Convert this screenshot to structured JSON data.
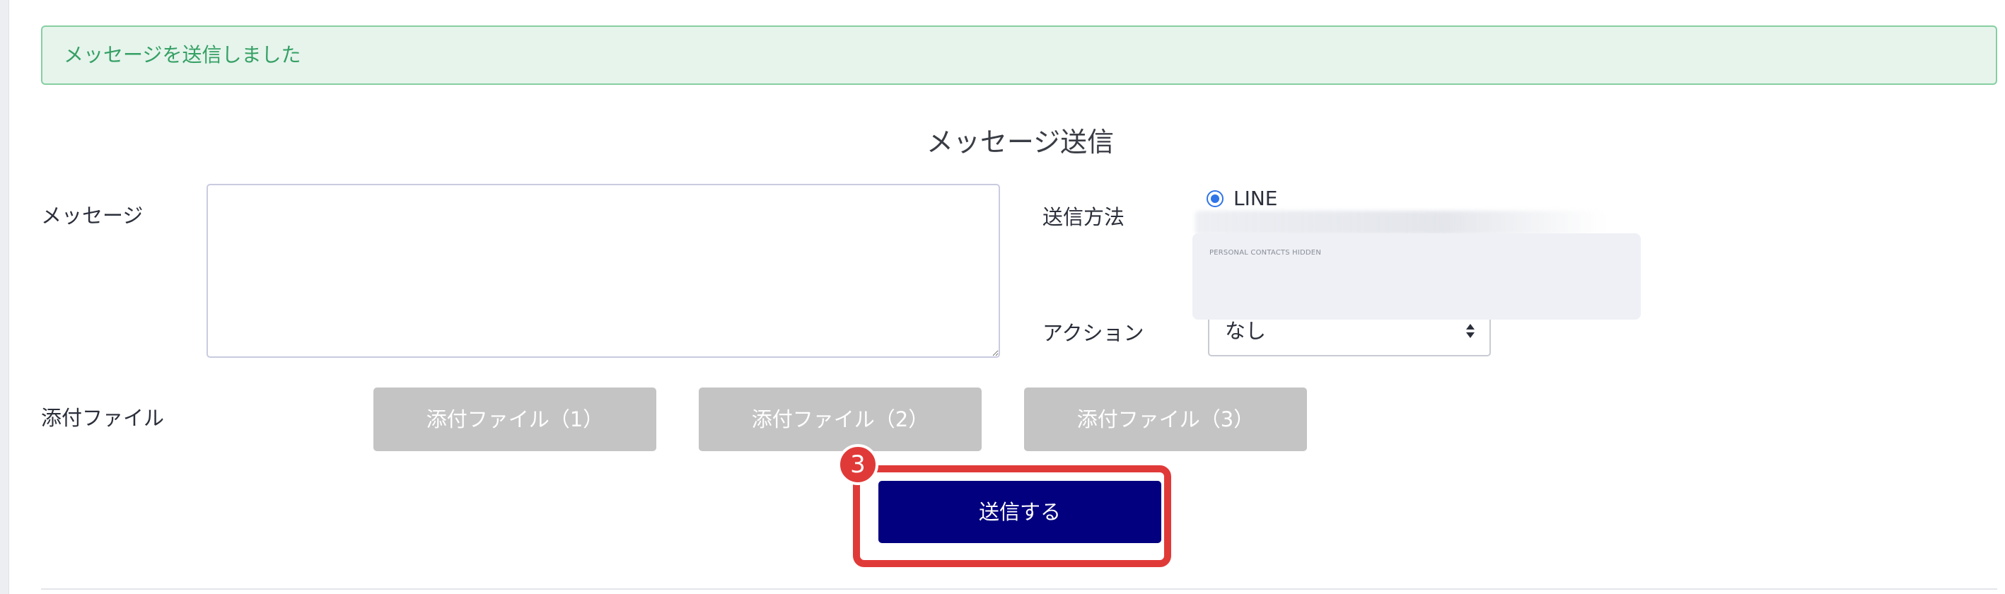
{
  "alert": {
    "text": "メッセージを送信しました"
  },
  "page_title": "メッセージ送信",
  "form": {
    "message_label": "メッセージ",
    "message_value": "",
    "send_method_label": "送信方法",
    "send_method_options": [
      {
        "label": "LINE",
        "selected": true
      }
    ],
    "hidden_notice": "PERSONAL CONTACTS HIDDEN",
    "action_label": "アクション",
    "action_selected": "なし",
    "attachments_label": "添付ファイル",
    "attachment_buttons": [
      {
        "label": "添付ファイル（1）"
      },
      {
        "label": "添付ファイル（2）"
      },
      {
        "label": "添付ファイル（3）"
      }
    ],
    "submit_label": "送信する"
  },
  "annotation": {
    "step_number": "3",
    "color": "#e03a38"
  },
  "colors": {
    "alert_bg": "#e6f4ec",
    "alert_text": "#35a064",
    "submit_bg": "#02007f",
    "attach_bg": "#c4c4c4",
    "radio_accent": "#2f74e8"
  }
}
